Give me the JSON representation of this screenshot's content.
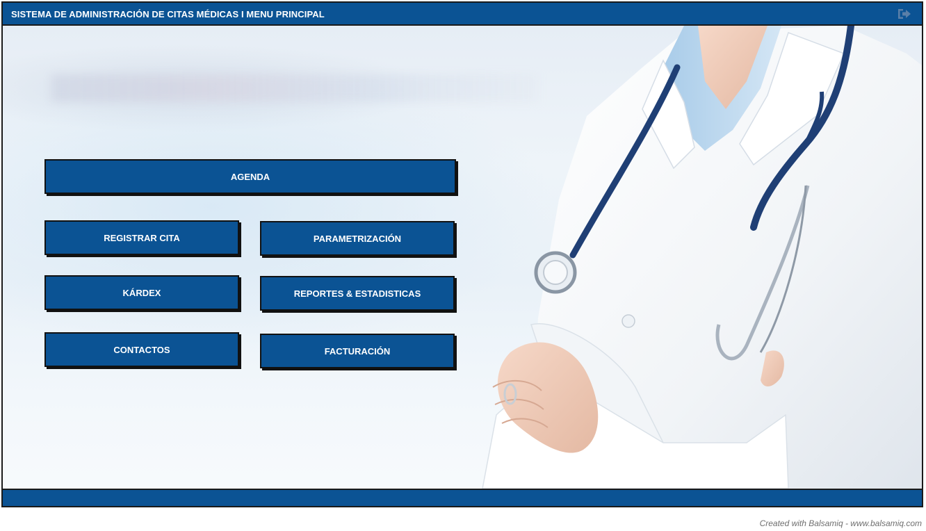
{
  "header": {
    "title": "SISTEMA DE ADMINISTRACIÓN DE CITAS MÉDICAS I MENU PRINCIPAL",
    "logout_icon": "sign-out-icon"
  },
  "menu": {
    "agenda": "AGENDA",
    "registrar_cita": "REGISTRAR CITA",
    "parametrizacion": "PARAMETRIZACIÓN",
    "kardex": "KÁRDEX",
    "reportes": "REPORTES & ESTADISTICAS",
    "contactos": "CONTACTOS",
    "facturacion": "FACTURACIÓN"
  },
  "credit": "Created with Balsamiq - www.balsamiq.com",
  "colors": {
    "primary": "#0b5394",
    "border": "#111111",
    "text_on_primary": "#ffffff"
  }
}
